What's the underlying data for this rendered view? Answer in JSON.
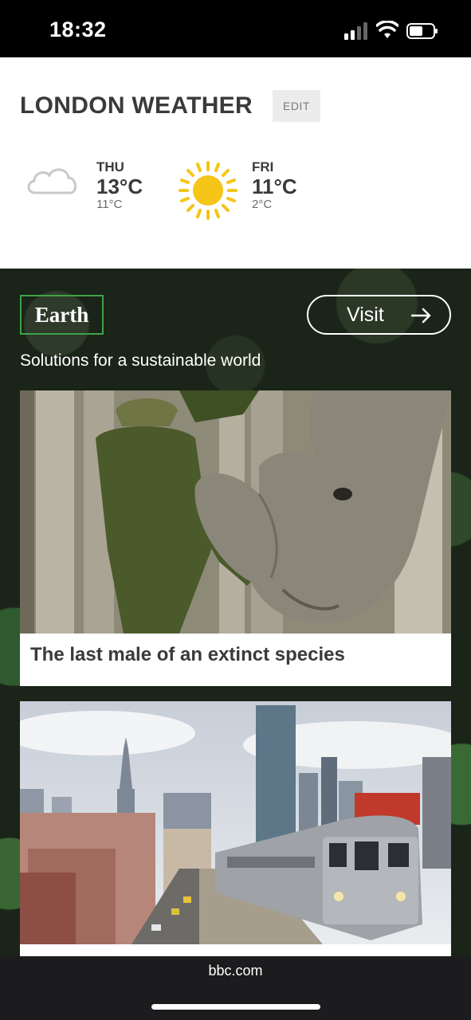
{
  "status_bar": {
    "time": "18:32"
  },
  "weather": {
    "title": "LONDON WEATHER",
    "edit_label": "EDIT",
    "days": [
      {
        "name": "THU",
        "high": "13°C",
        "low": "11°C",
        "icon": "cloud-icon"
      },
      {
        "name": "FRI",
        "high": "11°C",
        "low": "2°C",
        "icon": "sun-icon"
      }
    ]
  },
  "earth": {
    "badge": "Earth",
    "visit_label": "Visit",
    "subtitle": "Solutions for a sustainable world",
    "cards": [
      {
        "caption": "The last male of an extinct species",
        "image": "rhino-photo"
      },
      {
        "caption": "",
        "image": "city-train-photo"
      }
    ]
  },
  "browser": {
    "url": "bbc.com"
  },
  "colors": {
    "accent_green": "#3ea34a",
    "sun_yellow": "#f5c518"
  }
}
